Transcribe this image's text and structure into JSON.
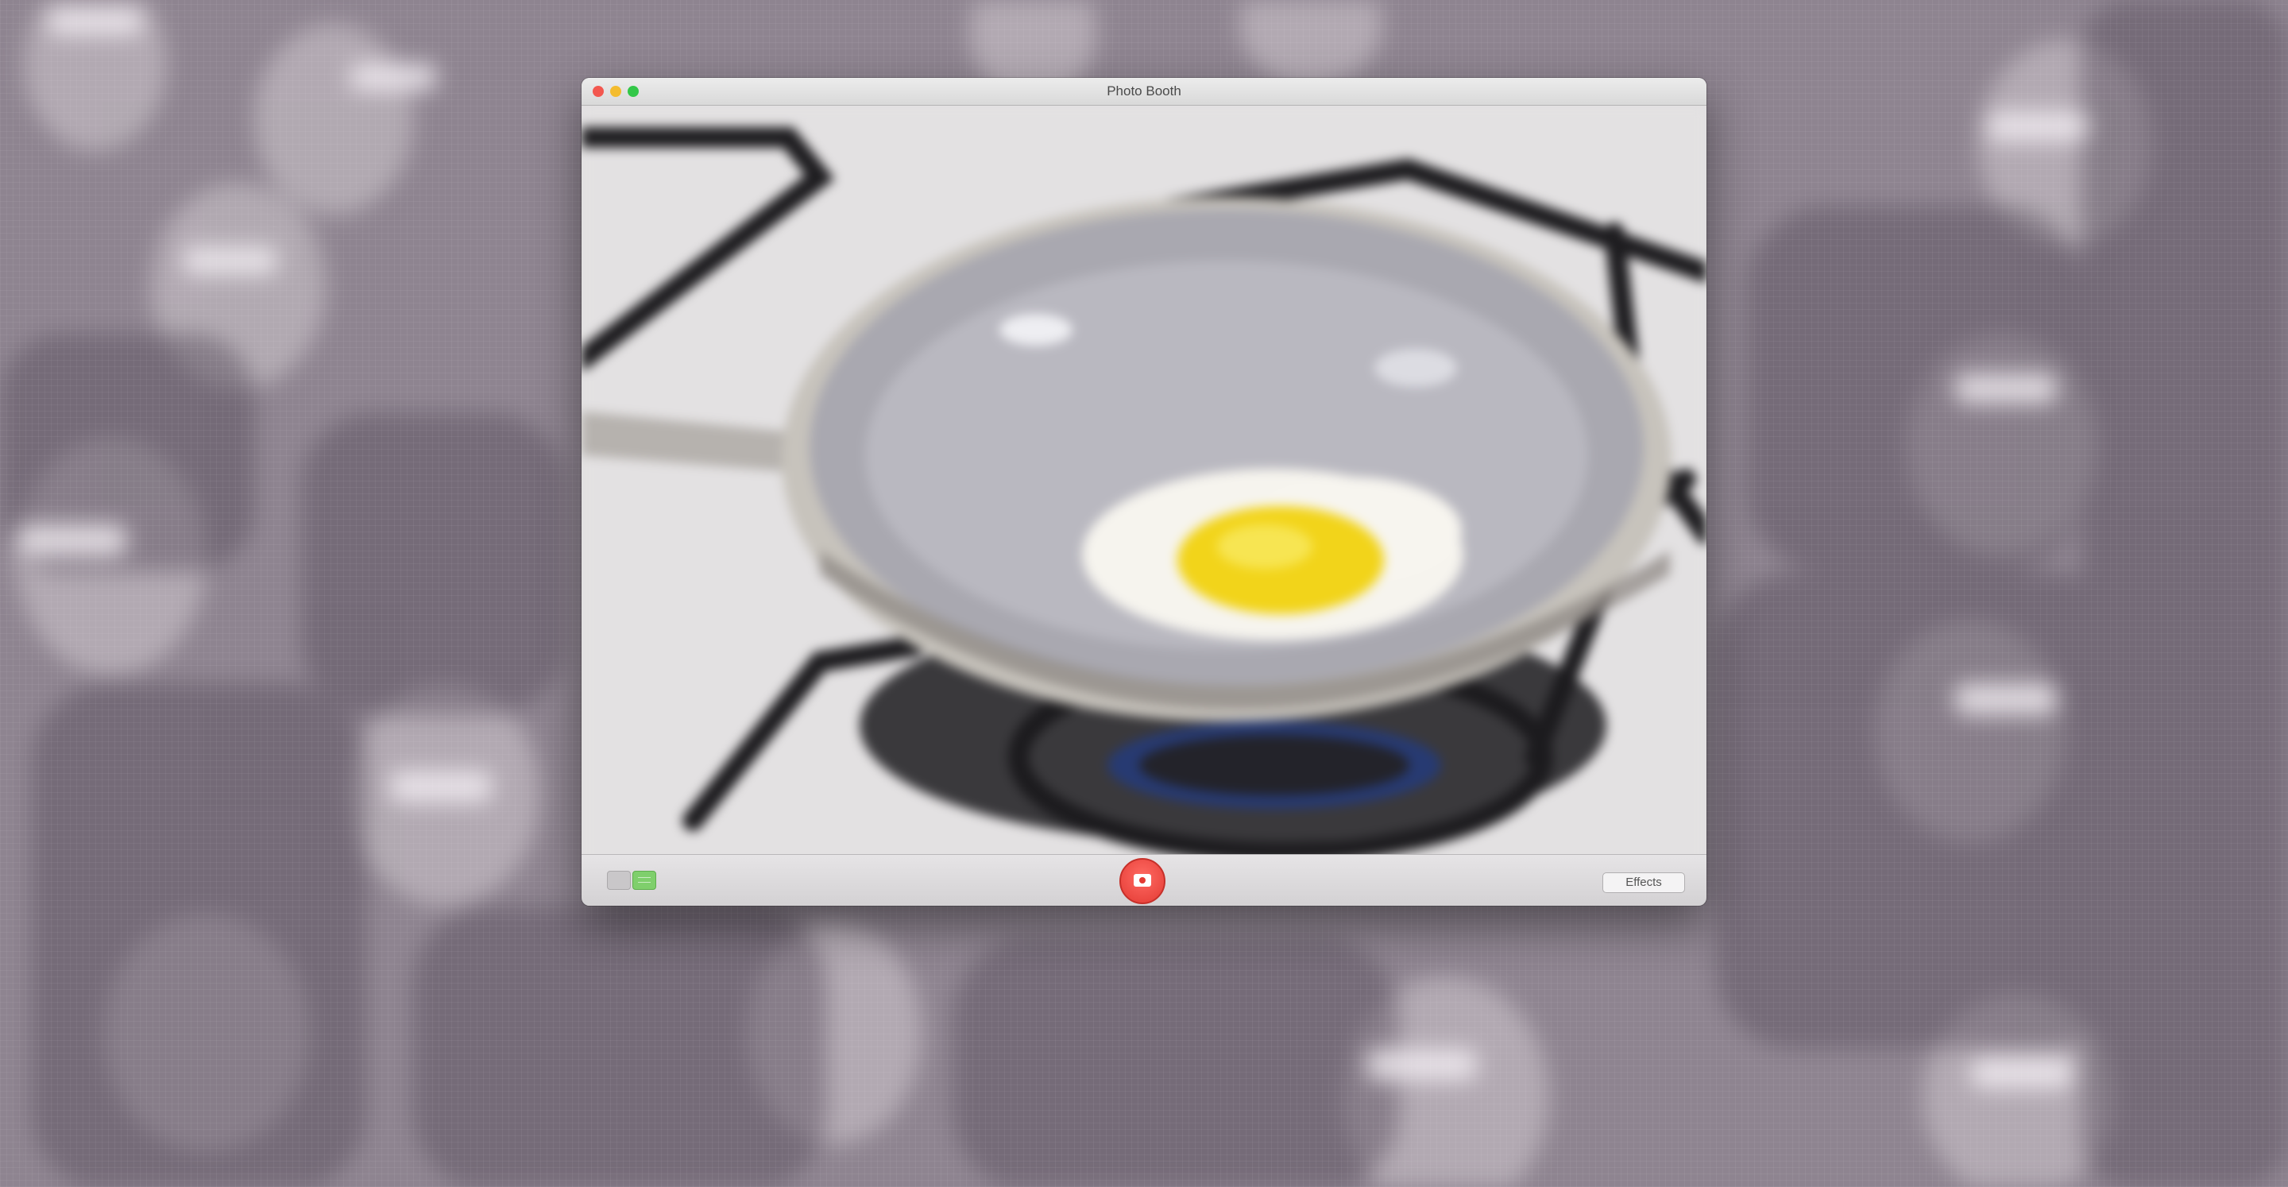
{
  "desktop": {
    "wallpaper_description_icon": "crowd-3d-glasses-wallpaper-icon",
    "wallpaper_tint": "#8f8591"
  },
  "window": {
    "title": "Photo Booth",
    "traffic_lights": {
      "close": "#f3574f",
      "minimize": "#f4bc2f",
      "maximize": "#33c748"
    }
  },
  "preview": {
    "scene_icon": "frying-pan-egg-preview-icon",
    "pan_color": "#b7b5bb",
    "yolk_color": "#f2d41a"
  },
  "strip": {
    "thumbnail_count": 13
  },
  "toolbar": {
    "single_photo_icon": "single-photo-mode-icon",
    "four_up_icon": "four-up-mode-icon",
    "shutter_icon": "camera-shutter-icon",
    "shutter_color": "#e33a33",
    "effects_label": "Effects"
  }
}
